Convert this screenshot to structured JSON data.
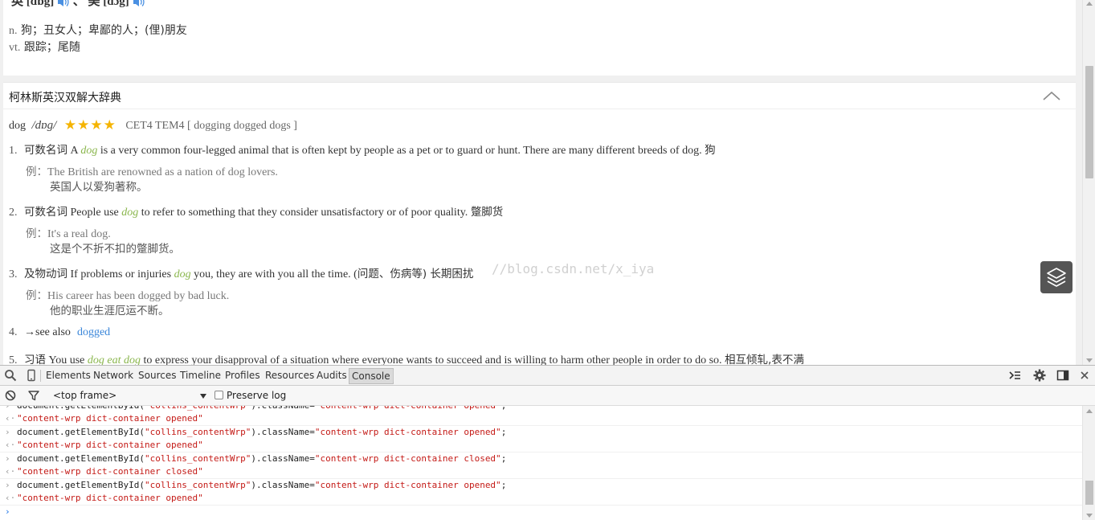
{
  "basic": {
    "pron_uk_label": "英",
    "pron_uk": "[dɒg]",
    "pron_sep": "、",
    "pron_us_label": "美",
    "pron_us": "[dɔg]",
    "defs": [
      {
        "pos": "n.",
        "text": " 狗；丑女人；卑鄙的人；(俚)朋友"
      },
      {
        "pos": "vt.",
        "text": " 跟踪；尾随"
      }
    ]
  },
  "collins": {
    "title": "柯林斯英汉双解大辞典",
    "headword": "dog",
    "phonetic": "/dɒg/",
    "stars": "★★★★",
    "tags": "CET4 TEM4 [ dogging dogged dogs ]",
    "senses": [
      {
        "num": "1.",
        "cat": "可数名词",
        "pre": " A ",
        "kw": "dog",
        "post": " is a very common four-legged animal that is often kept by people as a pet or to guard or hunt. There are many different breeds of dog. ",
        "cn": "狗",
        "ex_label": "例：",
        "ex_en": "The British are renowned as a nation of dog lovers.",
        "ex_cn": "英国人以爱狗著称。"
      },
      {
        "num": "2.",
        "cat": "可数名词",
        "pre": " People use ",
        "kw": "dog",
        "post": " to refer to something that they consider unsatisfactory or of poor quality. ",
        "cn": "蹩脚货",
        "ex_label": "例：",
        "ex_en": "It's a real dog.",
        "ex_cn": "这是个不折不扣的蹩脚货。"
      },
      {
        "num": "3.",
        "cat": "及物动词",
        "pre": " If problems or injuries ",
        "kw": "dog",
        "post": " you, they are with you all the time. (",
        "cn": "问题、伤病等) 长期困扰",
        "ex_label": "例：",
        "ex_en": "His career has been dogged by bad luck.",
        "ex_cn": "他的职业生涯厄运不断。"
      }
    ],
    "see_also": {
      "num": "4.",
      "text": "→see also",
      "link": "dogged"
    },
    "idiom": {
      "num": "5.",
      "cat": "习语",
      "pre": " You use ",
      "kw": "dog eat dog",
      "post": " to express your disapproval of a situation where everyone wants to succeed and is willing to harm other people in order to do so. ",
      "cn": "相互倾轧,表不满"
    }
  },
  "watermark": "//blog.csdn.net/x_iya",
  "devtools": {
    "tabs": [
      "Elements",
      "Network",
      "Sources",
      "Timeline",
      "Profiles",
      "Resources",
      "Audits",
      "Console"
    ],
    "active_tab": "Console",
    "frame": "<top frame>",
    "preserve_log": "Preserve log",
    "console": [
      {
        "type": "in",
        "code": "document.getElementById(\"collins_contentWrp\").className=\"content-wrp dict-container opened\";"
      },
      {
        "type": "out",
        "text": "\"content-wrp dict-container opened\""
      },
      {
        "type": "in",
        "code": "document.getElementById(\"collins_contentWrp\").className=\"content-wrp dict-container opened\";"
      },
      {
        "type": "out",
        "text": "\"content-wrp dict-container opened\""
      },
      {
        "type": "in",
        "code": "document.getElementById(\"collins_contentWrp\").className=\"content-wrp dict-container closed\";"
      },
      {
        "type": "out",
        "text": "\"content-wrp dict-container closed\""
      },
      {
        "type": "in",
        "code": "document.getElementById(\"collins_contentWrp\").className=\"content-wrp dict-container opened\";"
      },
      {
        "type": "out",
        "text": "\"content-wrp dict-container opened\""
      }
    ]
  },
  "colors": {
    "keyword": "#8ab64d",
    "link": "#3a86d9",
    "star": "#f5b400",
    "console_string": "#c41a16"
  }
}
